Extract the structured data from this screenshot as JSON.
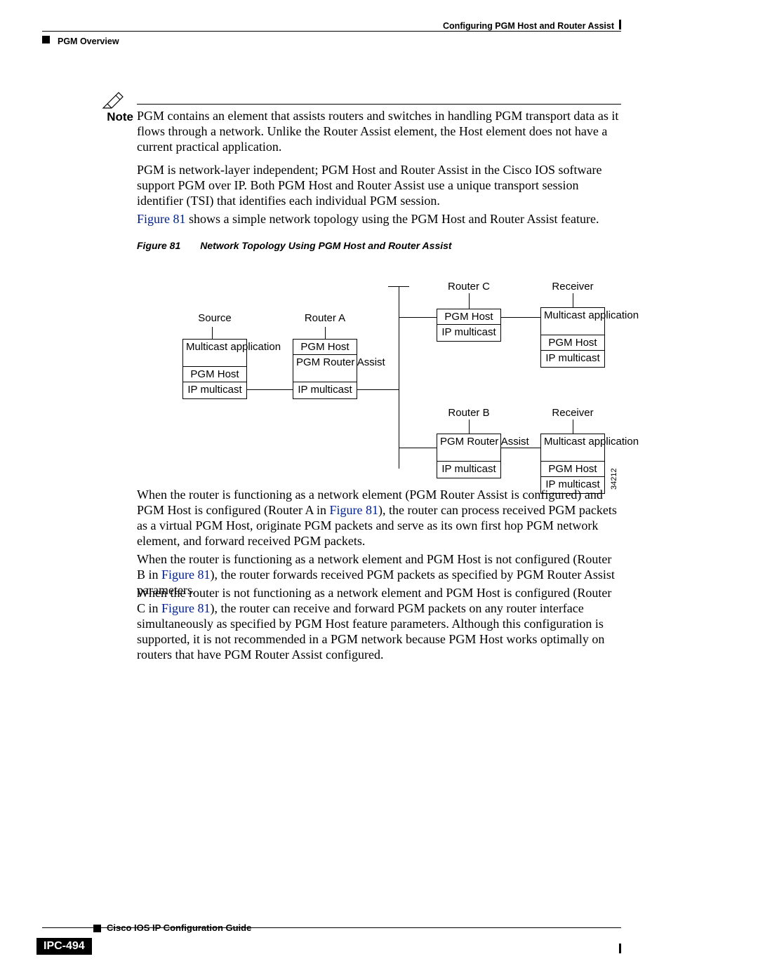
{
  "header": {
    "chapter": "Configuring PGM Host and Router Assist",
    "section": "PGM Overview"
  },
  "note": {
    "label": "Note",
    "body": "PGM contains an element that assists routers and switches in handling PGM transport data as it flows through a network. Unlike the Router Assist element, the Host element does not have a current practical application."
  },
  "paragraphs": {
    "p1": "PGM is network-layer independent; PGM Host and Router Assist in the Cisco IOS software support PGM over IP. Both PGM Host and Router Assist use a unique transport session identifier (TSI) that identifies each individual PGM session.",
    "p2_link": "Figure 81",
    "p2_tail": " shows a simple network topology using the PGM Host and Router Assist feature.",
    "p3_a": "When the router is functioning as a network element (PGM Router Assist is configured) and PGM Host is configured (Router A in ",
    "p3_link": "Figure 81",
    "p3_b": "), the router can process received PGM packets as a virtual PGM Host, originate PGM packets and serve as its own first hop PGM network element, and forward received PGM packets.",
    "p4_a": "When the router is functioning as a network element and PGM Host is not configured (Router B in ",
    "p4_link": "Figure 81",
    "p4_b": "), the router forwards received PGM packets as specified by PGM Router Assist parameters.",
    "p5_a": "When the router is not functioning as a network element and PGM Host is configured (Router C in ",
    "p5_link": "Figure 81",
    "p5_b": "), the router can receive and forward PGM packets on any router interface simultaneously as specified by PGM Host feature parameters. Although this configuration is supported, it is not recommended in a PGM network because PGM Host works optimally on routers that have PGM Router Assist configured."
  },
  "figure": {
    "number": "Figure 81",
    "caption": "Network Topology Using PGM Host and Router Assist",
    "id": "34212",
    "nodes": {
      "source": {
        "title": "Source",
        "layers": [
          "Multicast application",
          "PGM Host",
          "IP multicast"
        ]
      },
      "routerA": {
        "title": "Router A",
        "layers": [
          "PGM Host",
          "PGM Router Assist",
          "IP multicast"
        ]
      },
      "routerC": {
        "title": "Router C",
        "layers": [
          "PGM Host",
          "IP multicast"
        ]
      },
      "receiver1": {
        "title": "Receiver",
        "layers": [
          "Multicast application",
          "PGM Host",
          "IP multicast"
        ]
      },
      "routerB": {
        "title": "Router B",
        "layers": [
          "PGM Router Assist",
          "IP multicast"
        ]
      },
      "receiver2": {
        "title": "Receiver",
        "layers": [
          "Multicast application",
          "PGM Host",
          "IP multicast"
        ]
      }
    }
  },
  "footer": {
    "book": "Cisco IOS IP Configuration Guide",
    "page": "IPC-494"
  },
  "chart_data": {
    "type": "diagram",
    "note": "Network topology (not a quantitative chart). See figure.nodes for structure."
  }
}
